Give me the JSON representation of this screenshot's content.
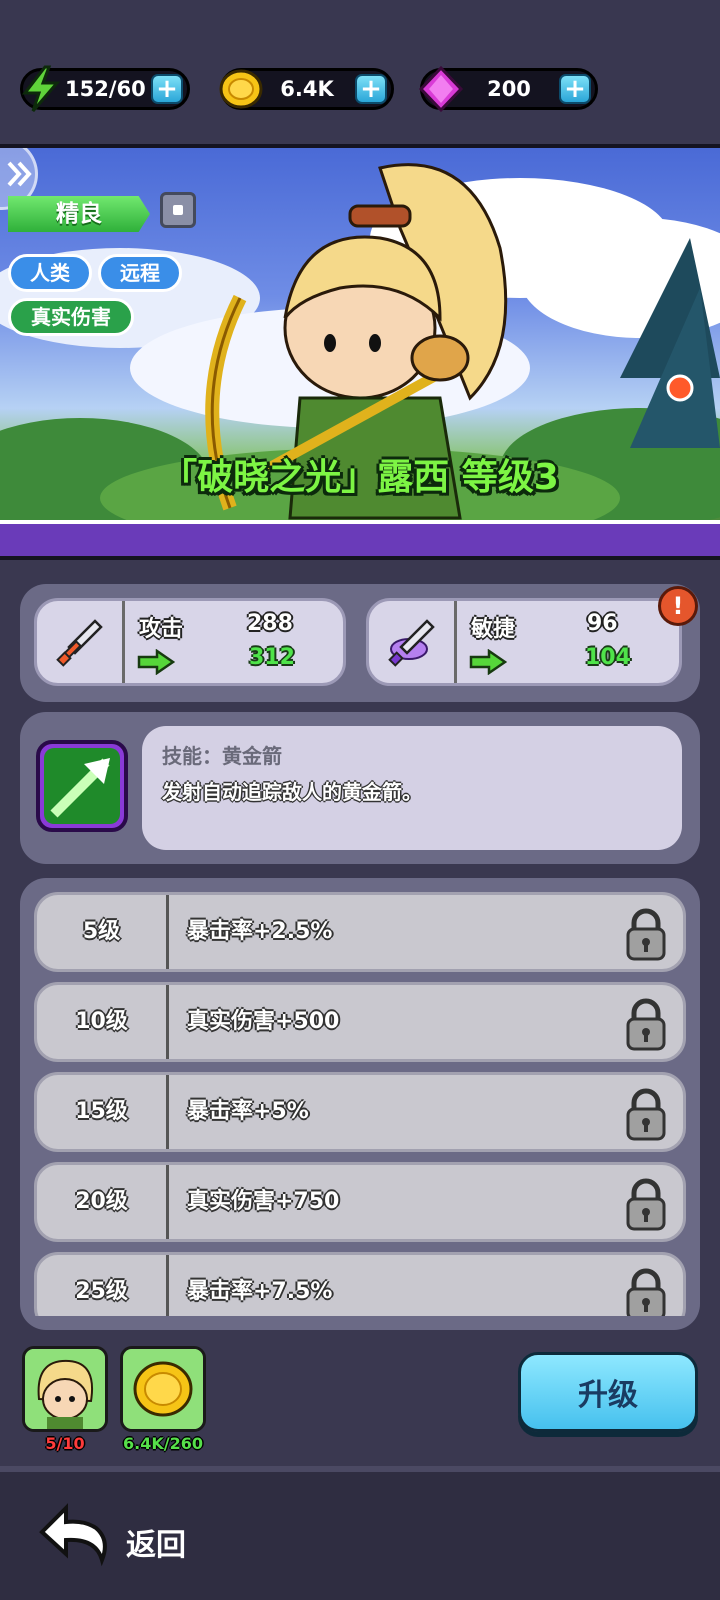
{
  "currency": {
    "energy": "152/60",
    "coins": "6.4K",
    "gems": "200"
  },
  "hero": {
    "rarity": "精良",
    "tags": [
      "人类",
      "远程",
      "真实伤害"
    ],
    "title": "「破晓之光」露西 等级3"
  },
  "stats": {
    "attack": {
      "label": "攻击",
      "current": "288",
      "next": "312"
    },
    "agility": {
      "label": "敏捷",
      "current": "96",
      "next": "104"
    }
  },
  "skill": {
    "title": "技能：黄金箭",
    "description": "发射自动追踪敌人的黄金箭。"
  },
  "level_bonuses": [
    {
      "level": "5级",
      "bonus": "暴击率+2.5%"
    },
    {
      "level": "10级",
      "bonus": "真实伤害+500"
    },
    {
      "level": "15级",
      "bonus": "暴击率+5%"
    },
    {
      "level": "20级",
      "bonus": "真实伤害+750"
    },
    {
      "level": "25级",
      "bonus": "暴击率+7.5%"
    }
  ],
  "requirements": {
    "shards": "5/10",
    "gold": "6.4K/260"
  },
  "colors": {
    "shards_text": "#ff3b3b",
    "gold_text": "#56e04a"
  },
  "buttons": {
    "upgrade": "升级",
    "back": "返回"
  }
}
